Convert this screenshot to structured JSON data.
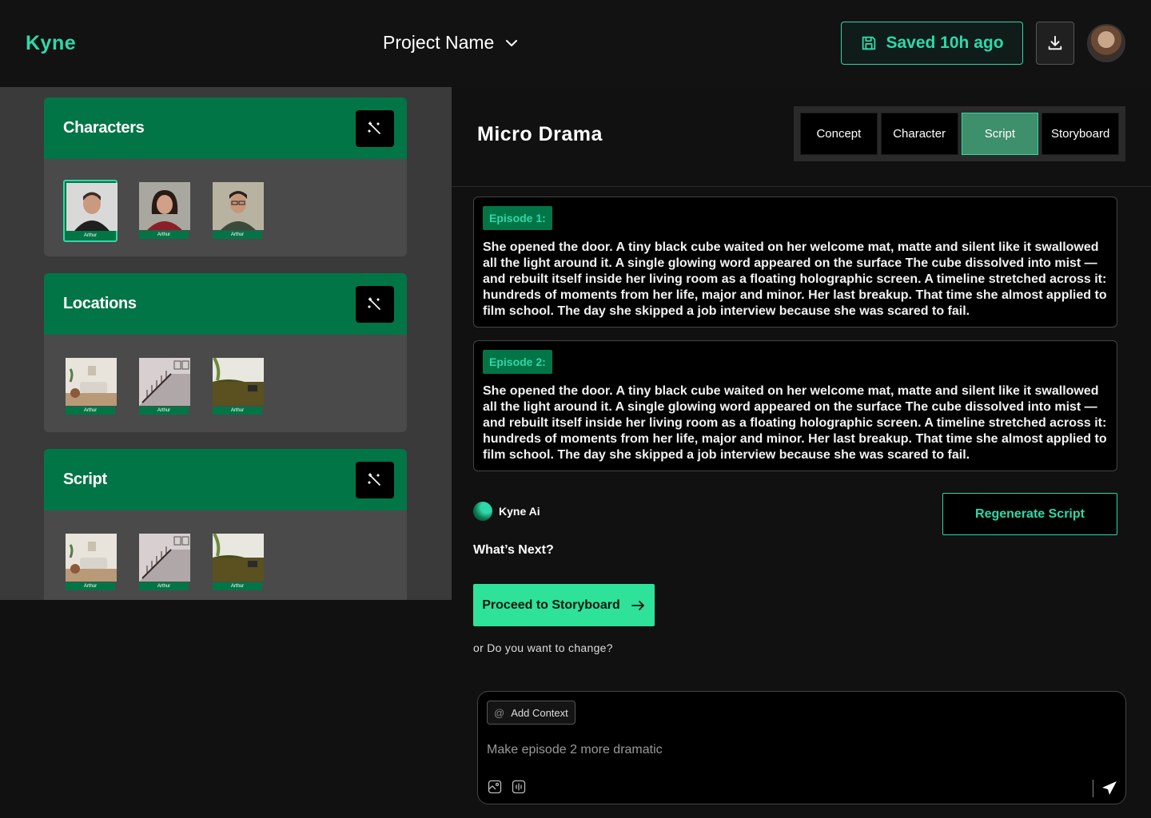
{
  "header": {
    "logo": "Kyne",
    "project_name": "Project Name",
    "saved_label": "Saved 10h ago",
    "download_icon": "download-icon",
    "avatar_icon": "user-avatar"
  },
  "sidebar": {
    "cards": [
      {
        "title": "Characters",
        "thumbs": [
          "Arthur",
          "Arthur",
          "Arthur"
        ],
        "selected_index": 0
      },
      {
        "title": "Locations",
        "thumbs": [
          "Arthur",
          "Arthur",
          "Arthur"
        ]
      },
      {
        "title": "Script",
        "thumbs": [
          "Arthur",
          "Arthur",
          "Arthur"
        ]
      }
    ]
  },
  "main": {
    "title": "Micro Drama",
    "tabs": [
      {
        "label": "Concept"
      },
      {
        "label": "Character"
      },
      {
        "label": "Script",
        "active": true
      },
      {
        "label": "Storyboard"
      }
    ],
    "episodes": [
      {
        "badge": "Episode 1:",
        "text": "She opened the door. A tiny black cube waited on her welcome mat, matte and silent like it swallowed all the light around it. A single glowing word appeared on the surface The cube dissolved into mist — and rebuilt itself inside her living room as a floating holographic screen. A timeline stretched across it: hundreds of moments from her life, major and minor. Her last breakup. That time she almost applied to film school. The day she skipped a job interview because she was scared to fail."
      },
      {
        "badge": "Episode 2:",
        "text": "She opened the door. A tiny black cube waited on her welcome mat, matte and silent like it swallowed all the light around it. A single glowing word appeared on the surface The cube dissolved into mist — and rebuilt itself inside her living room as a floating holographic screen. A timeline stretched across it: hundreds of moments from her life, major and minor. Her last breakup. That time she almost applied to film school. The day she skipped a job interview because she was scared to fail."
      }
    ],
    "ai_name": "Kyne Ai",
    "regenerate_label": "Regenerate Script",
    "whats_next": "What’s Next?",
    "proceed_label": "Proceed to Storyboard",
    "change_question": "or Do you want to change?"
  },
  "chat": {
    "add_context_label": "Add Context",
    "input_value": "Make episode 2 more dramatic"
  },
  "colors": {
    "accent": "#2fd8a8",
    "brand_green": "#027546",
    "proceed_green": "#2ee29a",
    "tab_active": "#3e8f6c"
  }
}
